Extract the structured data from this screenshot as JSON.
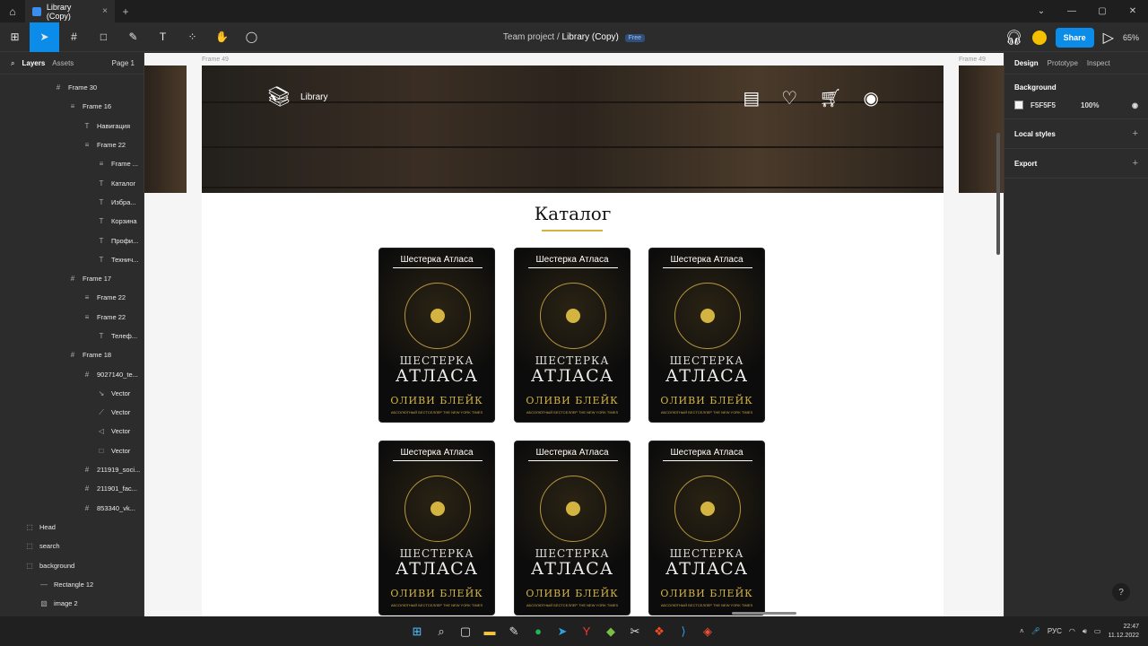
{
  "tab": {
    "title": "Library (Copy)",
    "close": "×",
    "new_tab": "+"
  },
  "window": {
    "minimize": "—",
    "maximize": "▢",
    "close": "✕",
    "dropdown": "⌄"
  },
  "breadcrumb": {
    "team": "Team project",
    "separator": "/",
    "file": "Library (Copy)",
    "badge": "Free"
  },
  "toolbar": {
    "share_label": "Share",
    "zoom": "65%"
  },
  "left_panel": {
    "tabs": [
      "Layers",
      "Assets"
    ],
    "page": "Page 1",
    "layers": [
      {
        "icon": "#",
        "name": "Frame 30",
        "indent": 60
      },
      {
        "icon": "≡",
        "name": "Frame 16",
        "indent": 76
      },
      {
        "icon": "T",
        "name": "Навигация",
        "indent": 92
      },
      {
        "icon": "≡",
        "name": "Frame 22",
        "indent": 92
      },
      {
        "icon": "≡",
        "name": "Frame ...",
        "indent": 108
      },
      {
        "icon": "T",
        "name": "Каталог",
        "indent": 108
      },
      {
        "icon": "T",
        "name": "Избра...",
        "indent": 108
      },
      {
        "icon": "T",
        "name": "Корзина",
        "indent": 108
      },
      {
        "icon": "T",
        "name": "Профи...",
        "indent": 108
      },
      {
        "icon": "T",
        "name": "Технич...",
        "indent": 108
      },
      {
        "icon": "#",
        "name": "Frame 17",
        "indent": 76
      },
      {
        "icon": "≡",
        "name": "Frame 22",
        "indent": 92
      },
      {
        "icon": "≡",
        "name": "Frame 22",
        "indent": 92
      },
      {
        "icon": "T",
        "name": "Телеф...",
        "indent": 108
      },
      {
        "icon": "#",
        "name": "Frame 18",
        "indent": 76
      },
      {
        "icon": "#",
        "name": "9027140_te...",
        "indent": 92
      },
      {
        "icon": "↘",
        "name": "Vector",
        "indent": 108
      },
      {
        "icon": "⟋",
        "name": "Vector",
        "indent": 108
      },
      {
        "icon": "◁",
        "name": "Vector",
        "indent": 108
      },
      {
        "icon": "□",
        "name": "Vector",
        "indent": 108
      },
      {
        "icon": "#",
        "name": "211919_soci...",
        "indent": 92
      },
      {
        "icon": "#",
        "name": "211901_fac...",
        "indent": 92
      },
      {
        "icon": "#",
        "name": "853340_vk...",
        "indent": 92
      },
      {
        "icon": "⬚",
        "name": "Head",
        "indent": 28
      },
      {
        "icon": "⬚",
        "name": "search",
        "indent": 28
      },
      {
        "icon": "⬚",
        "name": "background",
        "indent": 28
      },
      {
        "icon": "—",
        "name": "Rectangle 12",
        "indent": 44
      },
      {
        "icon": "▧",
        "name": "image 2",
        "indent": 44
      }
    ]
  },
  "right_panel": {
    "tabs": [
      "Design",
      "Prototype",
      "Inspect"
    ],
    "background_label": "Background",
    "bg_hex": "F5F5F5",
    "bg_opacity": "100%",
    "local_styles": "Local styles",
    "export": "Export",
    "plus": "+",
    "eye": "◉"
  },
  "canvas": {
    "frame_labels": [
      "Frame 49",
      "Frame 49"
    ],
    "logo_text": "Library",
    "catalog_title": "Каталог",
    "books": [
      {
        "label": "Шестерка Атласа",
        "title1": "ШЕСТЕРКА",
        "title2": "АТЛАСА",
        "author": "ОЛИВИ БЛЕЙК",
        "sub": "АБСОЛЮТНЫЙ БЕСТСЕЛЛЕР THE NEW YORK TIMES"
      },
      {
        "label": "Шестерка Атласа",
        "title1": "ШЕСТЕРКА",
        "title2": "АТЛАСА",
        "author": "ОЛИВИ БЛЕЙК",
        "sub": "АБСОЛЮТНЫЙ БЕСТСЕЛЛЕР THE NEW YORK TIMES"
      },
      {
        "label": "Шестерка Атласа",
        "title1": "ШЕСТЕРКА",
        "title2": "АТЛАСА",
        "author": "ОЛИВИ БЛЕЙК",
        "sub": "АБСОЛЮТНЫЙ БЕСТСЕЛЛЕР THE NEW YORK TIMES"
      },
      {
        "label": "Шестерка Атласа",
        "title1": "ШЕСТЕРКА",
        "title2": "АТЛАСА",
        "author": "ОЛИВИ БЛЕЙК",
        "sub": "АБСОЛЮТНЫЙ БЕСТСЕЛЛЕР THE NEW YORK TIMES"
      },
      {
        "label": "Шестерка Атласа",
        "title1": "ШЕСТЕРКА",
        "title2": "АТЛАСА",
        "author": "ОЛИВИ БЛЕЙК",
        "sub": "АБСОЛЮТНЫЙ БЕСТСЕЛЛЕР THE NEW YORK TIMES"
      },
      {
        "label": "Шестерка Атласа",
        "title1": "ШЕСТЕРКА",
        "title2": "АТЛАСА",
        "author": "ОЛИВИ БЛЕЙК",
        "sub": "АБСОЛЮТНЫЙ БЕСТСЕЛЛЕР THE NEW YORK TIMES"
      }
    ]
  },
  "help": "?",
  "taskbar": {
    "lang": "РУС",
    "time": "22:47",
    "date": "11.12.2022"
  },
  "colors": {
    "accent": "#0c8ce9",
    "gold": "#d4b440",
    "canvas": "#f5f5f5"
  }
}
